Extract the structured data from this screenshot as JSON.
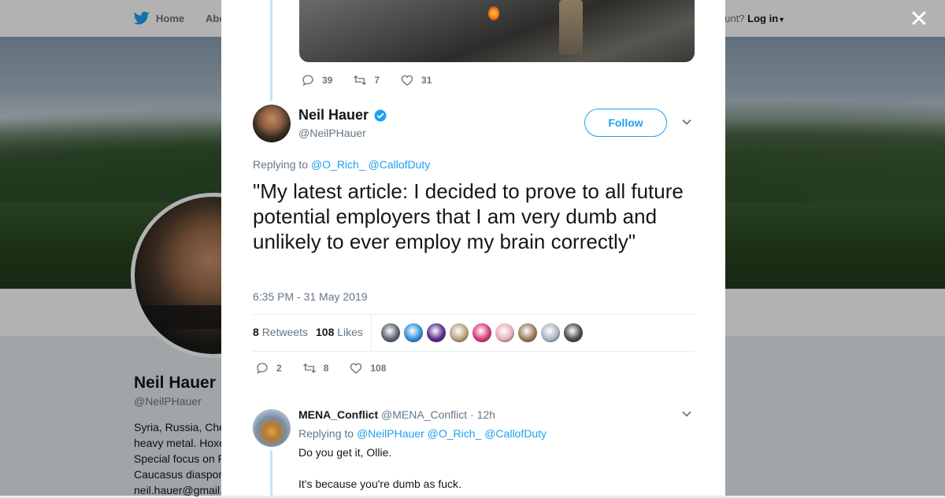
{
  "background": {
    "nav": {
      "home": "Home",
      "about": "Abo",
      "account_prompt": "ccount?",
      "login": "Log in"
    },
    "profile": {
      "name": "Neil Hauer",
      "handle": "@NeilPHauer",
      "bio_lines": [
        "Syria, Russia, Che",
        "heavy metal. Hoxe",
        "Special focus on F",
        "Caucasus diaspor",
        "neil.hauer@gmail."
      ]
    }
  },
  "modal": {
    "prev_tweet_actions": {
      "replies": "39",
      "retweets": "7",
      "likes": "31"
    },
    "tweet": {
      "author_name": "Neil Hauer",
      "author_handle": "@NeilPHauer",
      "follow_label": "Follow",
      "replying_prefix": "Replying to",
      "replying_to": [
        "@O_Rich_",
        "@CallofDuty"
      ],
      "text": "\"My latest article: I decided to prove to all future potential employers that I am very dumb and unlikely to ever employ my brain correctly\"",
      "timestamp": "6:35 PM - 31 May 2019",
      "retweets_count": "8",
      "retweets_label": "Retweets",
      "likes_count": "108",
      "likes_label": "Likes",
      "liker_avatar_colors": [
        "#5b6470",
        "#2f8fd8",
        "#5a2a8a",
        "#b9a27a",
        "#d83a7a",
        "#e8b0b8",
        "#9b7b55",
        "#aab6c2",
        "#4a4a4a"
      ],
      "actions": {
        "replies": "2",
        "retweets": "8",
        "likes": "108"
      }
    },
    "reply": {
      "author_name": "MENA_Conflict",
      "author_handle": "@MENA_Conflict",
      "time": "· 12h",
      "replying_prefix": "Replying to",
      "replying_to": [
        "@NeilPHauer",
        "@O_Rich_",
        "@CallofDuty"
      ],
      "lines": [
        "Do you get it, Ollie.",
        "It's because you're dumb as fuck."
      ]
    }
  },
  "colors": {
    "accent": "#1da1f2",
    "muted": "#657786",
    "text": "#14171a"
  }
}
